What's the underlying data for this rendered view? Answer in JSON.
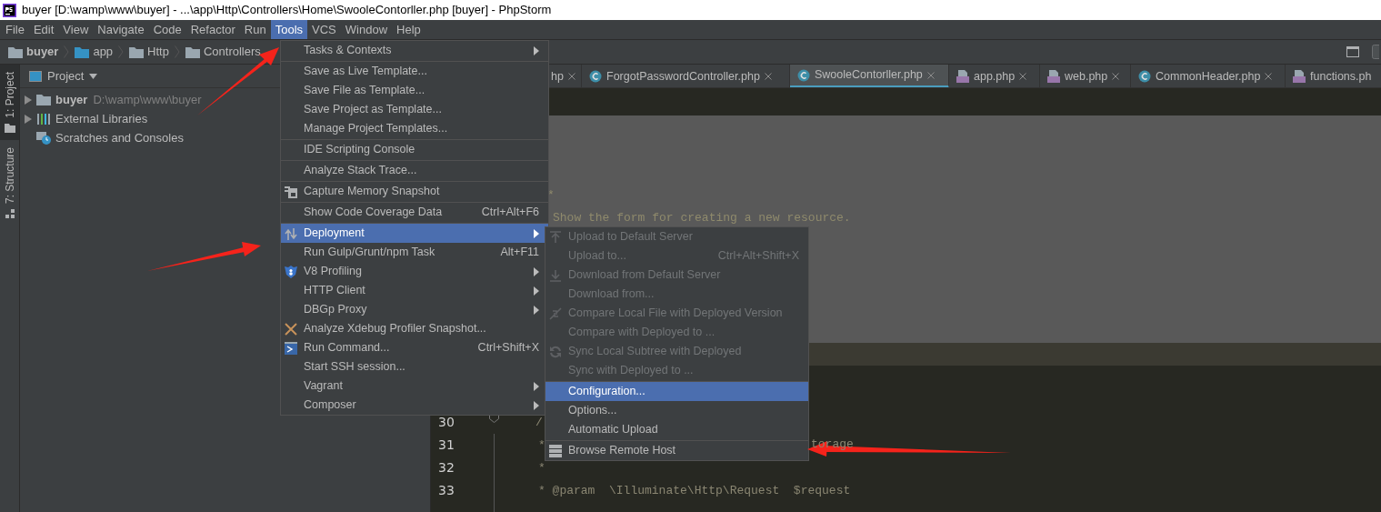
{
  "window": {
    "title": "buyer [D:\\wamp\\www\\buyer] - ...\\app\\Http\\Controllers\\Home\\SwooleContorller.php [buyer] - PhpStorm"
  },
  "menu_bar": [
    {
      "label": "File",
      "selected": false
    },
    {
      "label": "Edit",
      "selected": false
    },
    {
      "label": "View",
      "selected": false
    },
    {
      "label": "Navigate",
      "selected": false
    },
    {
      "label": "Code",
      "selected": false
    },
    {
      "label": "Refactor",
      "selected": false
    },
    {
      "label": "Run",
      "selected": false
    },
    {
      "label": "Tools",
      "selected": true
    },
    {
      "label": "VCS",
      "selected": false
    },
    {
      "label": "Window",
      "selected": false
    },
    {
      "label": "Help",
      "selected": false
    }
  ],
  "breadcrumbs": [
    {
      "label": "buyer",
      "bold": true
    },
    {
      "label": "app",
      "bold": false
    },
    {
      "label": "Http",
      "bold": false
    },
    {
      "label": "Controllers",
      "bold": false
    }
  ],
  "tool_strip": [
    {
      "label": "1: Project",
      "selected": true
    },
    {
      "label": "7: Structure",
      "selected": false
    }
  ],
  "project_panel": {
    "title": "Project",
    "items": [
      {
        "label": "buyer",
        "path": "D:\\wamp\\www\\buyer",
        "expandable": true
      },
      {
        "label": "External Libraries",
        "expandable": true
      },
      {
        "label": "Scratches and Consoles",
        "expandable": false
      }
    ]
  },
  "tabs": [
    {
      "label": "hp",
      "selected": false
    },
    {
      "label": "ForgotPasswordController.php",
      "kind": "class",
      "selected": false
    },
    {
      "label": "SwooleContorller.php",
      "kind": "class",
      "selected": true
    },
    {
      "label": "app.php",
      "kind": "php",
      "selected": false
    },
    {
      "label": "web.php",
      "kind": "php",
      "selected": false
    },
    {
      "label": "CommonHeader.php",
      "kind": "class",
      "selected": false
    },
    {
      "label": "functions.ph",
      "kind": "php",
      "selected": false
    }
  ],
  "editor": {
    "lines": [
      {
        "text": "*",
        "current": false,
        "fold_marker": false
      },
      {
        "text": "Show the form for creating a new resource.",
        "current": false,
        "fold_marker": false
      },
      {
        "current": true,
        "fold_marker": false
      },
      {
        "number": "30",
        "text": "/",
        "current": false,
        "fold_marker": true
      },
      {
        "number": "31",
        "text": "*",
        "text_after_popup": "torage",
        "current": false,
        "fold_marker": false
      },
      {
        "number": "32",
        "text": "*",
        "current": false,
        "fold_marker": false
      },
      {
        "number": "33",
        "text": "* @param  \\Illuminate\\Http\\Request  $request",
        "current": false,
        "fold_marker": false
      }
    ]
  },
  "tools_menu": [
    {
      "kind": "item",
      "label": "Tasks & Contexts",
      "submenu": true,
      "selected": false,
      "disabled": false
    },
    {
      "kind": "separator"
    },
    {
      "kind": "item",
      "label": "Save as Live Template...",
      "submenu": false,
      "selected": false,
      "disabled": false
    },
    {
      "kind": "item",
      "label": "Save File as Template...",
      "submenu": false,
      "selected": false,
      "disabled": false
    },
    {
      "kind": "item",
      "label": "Save Project as Template...",
      "submenu": false,
      "selected": false,
      "disabled": false
    },
    {
      "kind": "item",
      "label": "Manage Project Templates...",
      "submenu": false,
      "selected": false,
      "disabled": false
    },
    {
      "kind": "separator"
    },
    {
      "kind": "item",
      "label": "IDE Scripting Console",
      "submenu": false,
      "selected": false,
      "disabled": false
    },
    {
      "kind": "separator"
    },
    {
      "kind": "item",
      "label": "Analyze Stack Trace...",
      "submenu": false,
      "selected": false,
      "disabled": false
    },
    {
      "kind": "separator"
    },
    {
      "kind": "item",
      "label": "Capture Memory Snapshot",
      "submenu": false,
      "selected": false,
      "disabled": false
    },
    {
      "kind": "separator"
    },
    {
      "kind": "item",
      "label": "Show Code Coverage Data",
      "shortcut": "Ctrl+Alt+F6",
      "submenu": false,
      "selected": false,
      "disabled": false
    },
    {
      "kind": "separator"
    },
    {
      "kind": "item",
      "label": "Deployment",
      "submenu": true,
      "selected": true,
      "disabled": false
    },
    {
      "kind": "item",
      "label": "Run Gulp/Grunt/npm Task",
      "shortcut": "Alt+F11",
      "submenu": false,
      "selected": false,
      "disabled": false
    },
    {
      "kind": "item",
      "label": "V8 Profiling",
      "submenu": true,
      "selected": false,
      "disabled": false
    },
    {
      "kind": "item",
      "label": "HTTP Client",
      "submenu": true,
      "selected": false,
      "disabled": false
    },
    {
      "kind": "item",
      "label": "DBGp Proxy",
      "submenu": true,
      "selected": false,
      "disabled": false
    },
    {
      "kind": "item",
      "label": "Analyze Xdebug Profiler Snapshot...",
      "submenu": false,
      "selected": false,
      "disabled": false
    },
    {
      "kind": "item",
      "label": "Run Command...",
      "shortcut": "Ctrl+Shift+X",
      "submenu": false,
      "selected": false,
      "disabled": false
    },
    {
      "kind": "item",
      "label": "Start SSH session...",
      "submenu": false,
      "selected": false,
      "disabled": false
    },
    {
      "kind": "item",
      "label": "Vagrant",
      "submenu": true,
      "selected": false,
      "disabled": false
    },
    {
      "kind": "item",
      "label": "Composer",
      "submenu": true,
      "selected": false,
      "disabled": false
    }
  ],
  "deployment_menu": [
    {
      "kind": "item",
      "label": "Upload to Default Server",
      "selected": false,
      "disabled": true
    },
    {
      "kind": "item",
      "label": "Upload to...",
      "shortcut": "Ctrl+Alt+Shift+X",
      "selected": false,
      "disabled": true
    },
    {
      "kind": "item",
      "label": "Download from Default Server",
      "selected": false,
      "disabled": true
    },
    {
      "kind": "item",
      "label": "Download from...",
      "selected": false,
      "disabled": true
    },
    {
      "kind": "item",
      "label": "Compare Local File with Deployed Version",
      "selected": false,
      "disabled": true
    },
    {
      "kind": "item",
      "label": "Compare with Deployed to ...",
      "selected": false,
      "disabled": true
    },
    {
      "kind": "item",
      "label": "Sync Local Subtree with Deployed",
      "selected": false,
      "disabled": true
    },
    {
      "kind": "item",
      "label": "Sync with Deployed to ...",
      "selected": false,
      "disabled": true
    },
    {
      "kind": "separator"
    },
    {
      "kind": "item",
      "label": "Configuration...",
      "selected": true,
      "disabled": false
    },
    {
      "kind": "item",
      "label": "Options...",
      "selected": false,
      "disabled": false
    },
    {
      "kind": "item",
      "label": "Automatic Upload",
      "selected": false,
      "disabled": false
    },
    {
      "kind": "separator"
    },
    {
      "kind": "item",
      "label": "Browse Remote Host",
      "selected": false,
      "disabled": false
    }
  ]
}
